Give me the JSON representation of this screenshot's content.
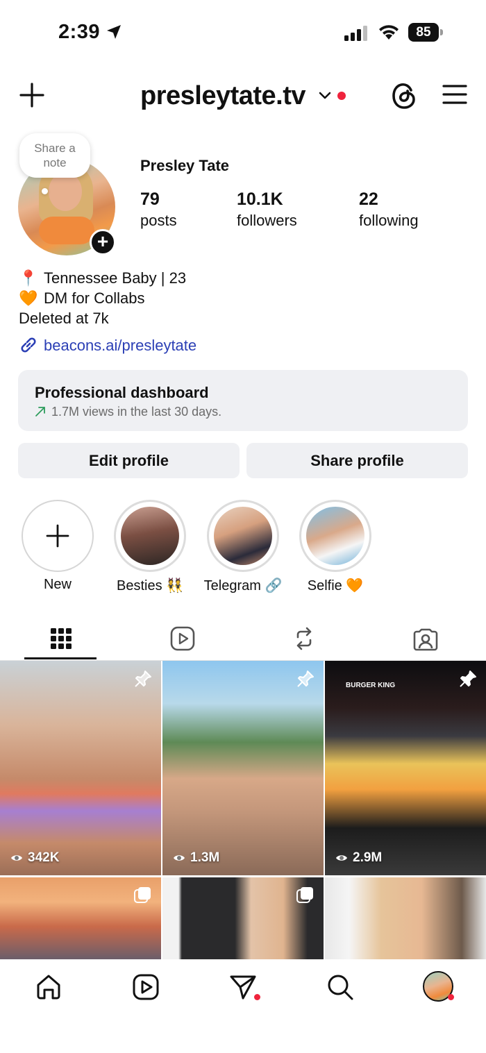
{
  "status_bar": {
    "time": "2:39",
    "battery": "85"
  },
  "header": {
    "username": "presleytate.tv"
  },
  "note_bubble": {
    "text_line1": "Share a",
    "text_line2": "note"
  },
  "profile": {
    "name": "Presley Tate",
    "stats": [
      {
        "count": "79",
        "label": "posts"
      },
      {
        "count": "10.1K",
        "label": "followers"
      },
      {
        "count": "22",
        "label": "following"
      }
    ],
    "bio": [
      {
        "emoji": "📍",
        "text": "Tennessee Baby | 23"
      },
      {
        "emoji": "🧡",
        "text": "DM for Collabs"
      },
      {
        "emoji": "",
        "text": "Deleted at 7k"
      }
    ],
    "link": "beacons.ai/presleytate"
  },
  "dashboard": {
    "title": "Professional dashboard",
    "subtitle": "1.7M views in the last 30 days."
  },
  "buttons": {
    "edit": "Edit profile",
    "share": "Share profile"
  },
  "highlights": [
    {
      "label": "New"
    },
    {
      "label": "Besties 👯"
    },
    {
      "label": "Telegram 🔗"
    },
    {
      "label": "Selfie 🧡"
    }
  ],
  "grid": [
    {
      "views": "342K",
      "pinned": true
    },
    {
      "views": "1.3M",
      "pinned": true
    },
    {
      "views": "2.9M",
      "pinned": true,
      "sign": "BURGER KING"
    },
    {
      "views": "",
      "multi": true
    },
    {
      "views": "",
      "multi": true
    },
    {
      "views": "",
      "multi": false
    }
  ],
  "colors": {
    "link": "#2b3fb5",
    "notification": "#ef233c",
    "button_bg": "#eff0f3"
  }
}
